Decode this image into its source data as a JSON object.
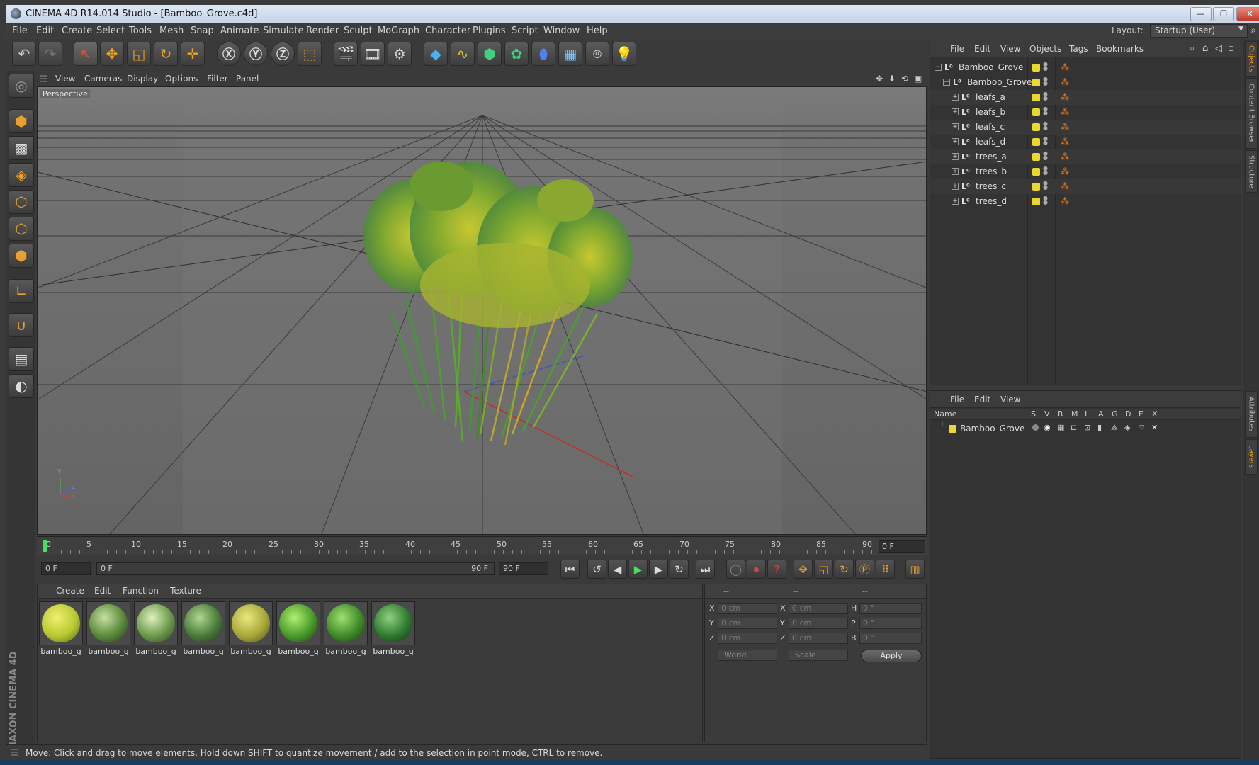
{
  "window": {
    "title": "CINEMA 4D R14.014 Studio - [Bamboo_Grove.c4d]",
    "minimize": "—",
    "restore": "❐",
    "close": "✕"
  },
  "menubar": {
    "items": [
      "File",
      "Edit",
      "Create",
      "Select",
      "Tools",
      "Mesh",
      "Snap",
      "Animate",
      "Simulate",
      "Render",
      "Sculpt",
      "MoGraph",
      "Character",
      "Plugins",
      "Script",
      "Window",
      "Help"
    ],
    "layout_label": "Layout:",
    "layout_value": "Startup (User)"
  },
  "viewport": {
    "menu": [
      "View",
      "Cameras",
      "Display",
      "Options",
      "Filter",
      "Panel"
    ],
    "label": "Perspective",
    "axis_y": "Y",
    "axis_x": "X",
    "axis_z": "Z"
  },
  "timeline": {
    "ticks": [
      "0",
      "5",
      "10",
      "15",
      "20",
      "25",
      "30",
      "35",
      "40",
      "45",
      "50",
      "55",
      "60",
      "65",
      "70",
      "75",
      "80",
      "85",
      "90"
    ],
    "current_frame": "0 F"
  },
  "transport": {
    "start_field": "0 F",
    "range_start": "0 F",
    "range_end": "90 F",
    "end_field": "90 F"
  },
  "materials": {
    "menu": [
      "Create",
      "Edit",
      "Function",
      "Texture"
    ],
    "items": [
      {
        "label": "bamboo_g",
        "color": "#b8c830"
      },
      {
        "label": "bamboo_g",
        "color": "#5a8a3a"
      },
      {
        "label": "bamboo_g",
        "color": "#6a9a4a"
      },
      {
        "label": "bamboo_g",
        "color": "#4a7a3a"
      },
      {
        "label": "bamboo_g",
        "color": "#a8a838"
      },
      {
        "label": "bamboo_g",
        "color": "#4a9a2a"
      },
      {
        "label": "bamboo_g",
        "color": "#3f8a28"
      },
      {
        "label": "bamboo_g",
        "color": "#2f7a30"
      }
    ]
  },
  "coordinates": {
    "header": [
      "--",
      "--",
      "--"
    ],
    "rows": [
      {
        "l1": "X",
        "v1": "0 cm",
        "l2": "X",
        "v2": "0 cm",
        "l3": "H",
        "v3": "0 °"
      },
      {
        "l1": "Y",
        "v1": "0 cm",
        "l2": "Y",
        "v2": "0 cm",
        "l3": "P",
        "v3": "0 °"
      },
      {
        "l1": "Z",
        "v1": "0 cm",
        "l2": "Z",
        "v2": "0 cm",
        "l3": "B",
        "v3": "0 °"
      }
    ],
    "space": "World",
    "mode": "Scale",
    "apply": "Apply"
  },
  "status": {
    "text": "Move: Click and drag to move elements. Hold down SHIFT to quantize movement / add to the selection in point mode, CTRL to remove."
  },
  "object_manager": {
    "menu": [
      "File",
      "Edit",
      "View",
      "Objects",
      "Tags",
      "Bookmarks"
    ],
    "objects": [
      {
        "name": "Bamboo_Grove",
        "level": 0
      },
      {
        "name": "Bamboo_Grove",
        "level": 1
      },
      {
        "name": "leafs_a",
        "level": 2
      },
      {
        "name": "leafs_b",
        "level": 2
      },
      {
        "name": "leafs_c",
        "level": 2
      },
      {
        "name": "leafs_d",
        "level": 2
      },
      {
        "name": "trees_a",
        "level": 2
      },
      {
        "name": "trees_b",
        "level": 2
      },
      {
        "name": "trees_c",
        "level": 2
      },
      {
        "name": "trees_d",
        "level": 2
      }
    ]
  },
  "layer_manager": {
    "menu": [
      "File",
      "Edit",
      "View"
    ],
    "columns": [
      "Name",
      "S",
      "V",
      "R",
      "M",
      "L",
      "A",
      "G",
      "D",
      "E",
      "X"
    ],
    "layers": [
      {
        "name": "Bamboo_Grove",
        "color": "#e8d830"
      }
    ]
  },
  "side_tabs": [
    "Objects",
    "Content Browser",
    "Structure",
    "Attributes",
    "Layers"
  ],
  "brand": "MAXON CINEMA 4D",
  "colors": {
    "accent": "#f0a020",
    "layer_yellow": "#e8d830"
  }
}
